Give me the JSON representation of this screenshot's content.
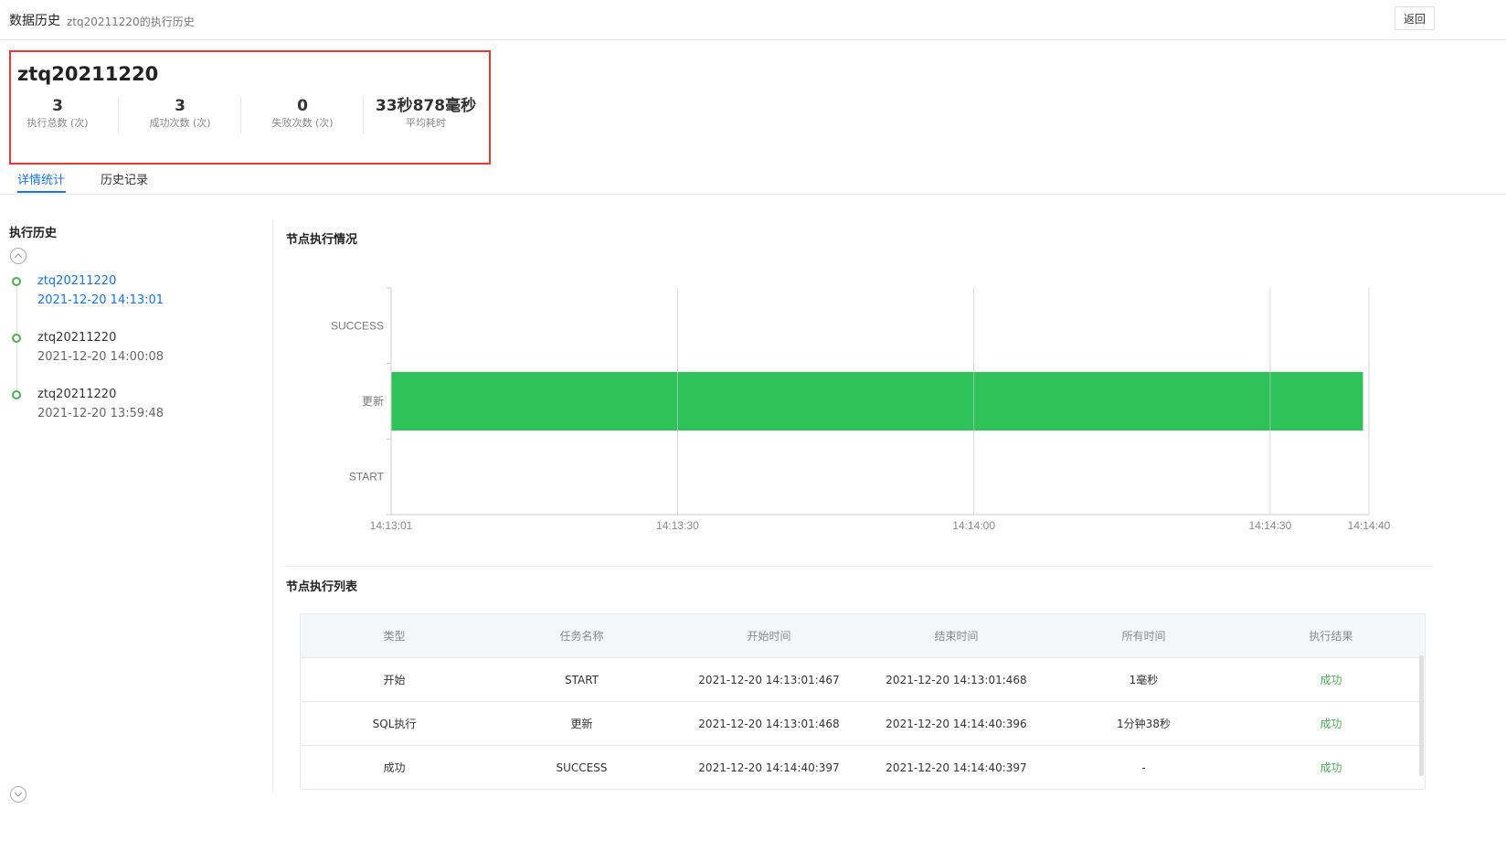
{
  "header": {
    "title": "数据历史",
    "subtitle": "ztq20211220的执行历史",
    "back_label": "返回"
  },
  "summary": {
    "name": "ztq20211220",
    "stats": [
      {
        "value": "3",
        "label": "执行总数 (次)"
      },
      {
        "value": "3",
        "label": "成功次数 (次)"
      },
      {
        "value": "0",
        "label": "失败次数 (次)"
      },
      {
        "value": "33秒878毫秒",
        "label": "平均耗时"
      }
    ]
  },
  "tabs": [
    {
      "label": "详情统计",
      "active": true
    },
    {
      "label": "历史记录",
      "active": false
    }
  ],
  "history": {
    "title": "执行历史",
    "items": [
      {
        "name": "ztq20211220",
        "time": "2021-12-20 14:13:01",
        "active": true
      },
      {
        "name": "ztq20211220",
        "time": "2021-12-20 14:00:08",
        "active": false
      },
      {
        "name": "ztq20211220",
        "time": "2021-12-20 13:59:48",
        "active": false
      }
    ]
  },
  "chart_section": {
    "title": "节点执行情况"
  },
  "chart_data": {
    "type": "bar",
    "orientation": "horizontal-gantt",
    "categories": [
      "SUCCESS",
      "更新",
      "START"
    ],
    "x_ticks": [
      "14:13:01",
      "14:13:30",
      "14:14:00",
      "14:14:30",
      "14:14:40"
    ],
    "x_tick_seconds": [
      1,
      30,
      60,
      90,
      100
    ],
    "xlim": [
      1,
      100
    ],
    "bars": [
      {
        "category": "更新",
        "start": "14:13:01",
        "end": "14:14:40",
        "start_s": 1,
        "end_s": 99.4
      }
    ],
    "bar_color": "#2fc25b",
    "grid": true
  },
  "table_section": {
    "title": "节点执行列表"
  },
  "table": {
    "columns": [
      "类型",
      "任务名称",
      "开始时间",
      "结束时间",
      "所有时间",
      "执行结果"
    ],
    "rows": [
      [
        "开始",
        "START",
        "2021-12-20 14:13:01:467",
        "2021-12-20 14:13:01:468",
        "1毫秒",
        "成功"
      ],
      [
        "SQL执行",
        "更新",
        "2021-12-20 14:13:01:468",
        "2021-12-20 14:14:40:396",
        "1分钟38秒",
        "成功"
      ],
      [
        "成功",
        "SUCCESS",
        "2021-12-20 14:14:40:397",
        "2021-12-20 14:14:40:397",
        "-",
        "成功"
      ]
    ],
    "success_color": "#4caf50"
  }
}
